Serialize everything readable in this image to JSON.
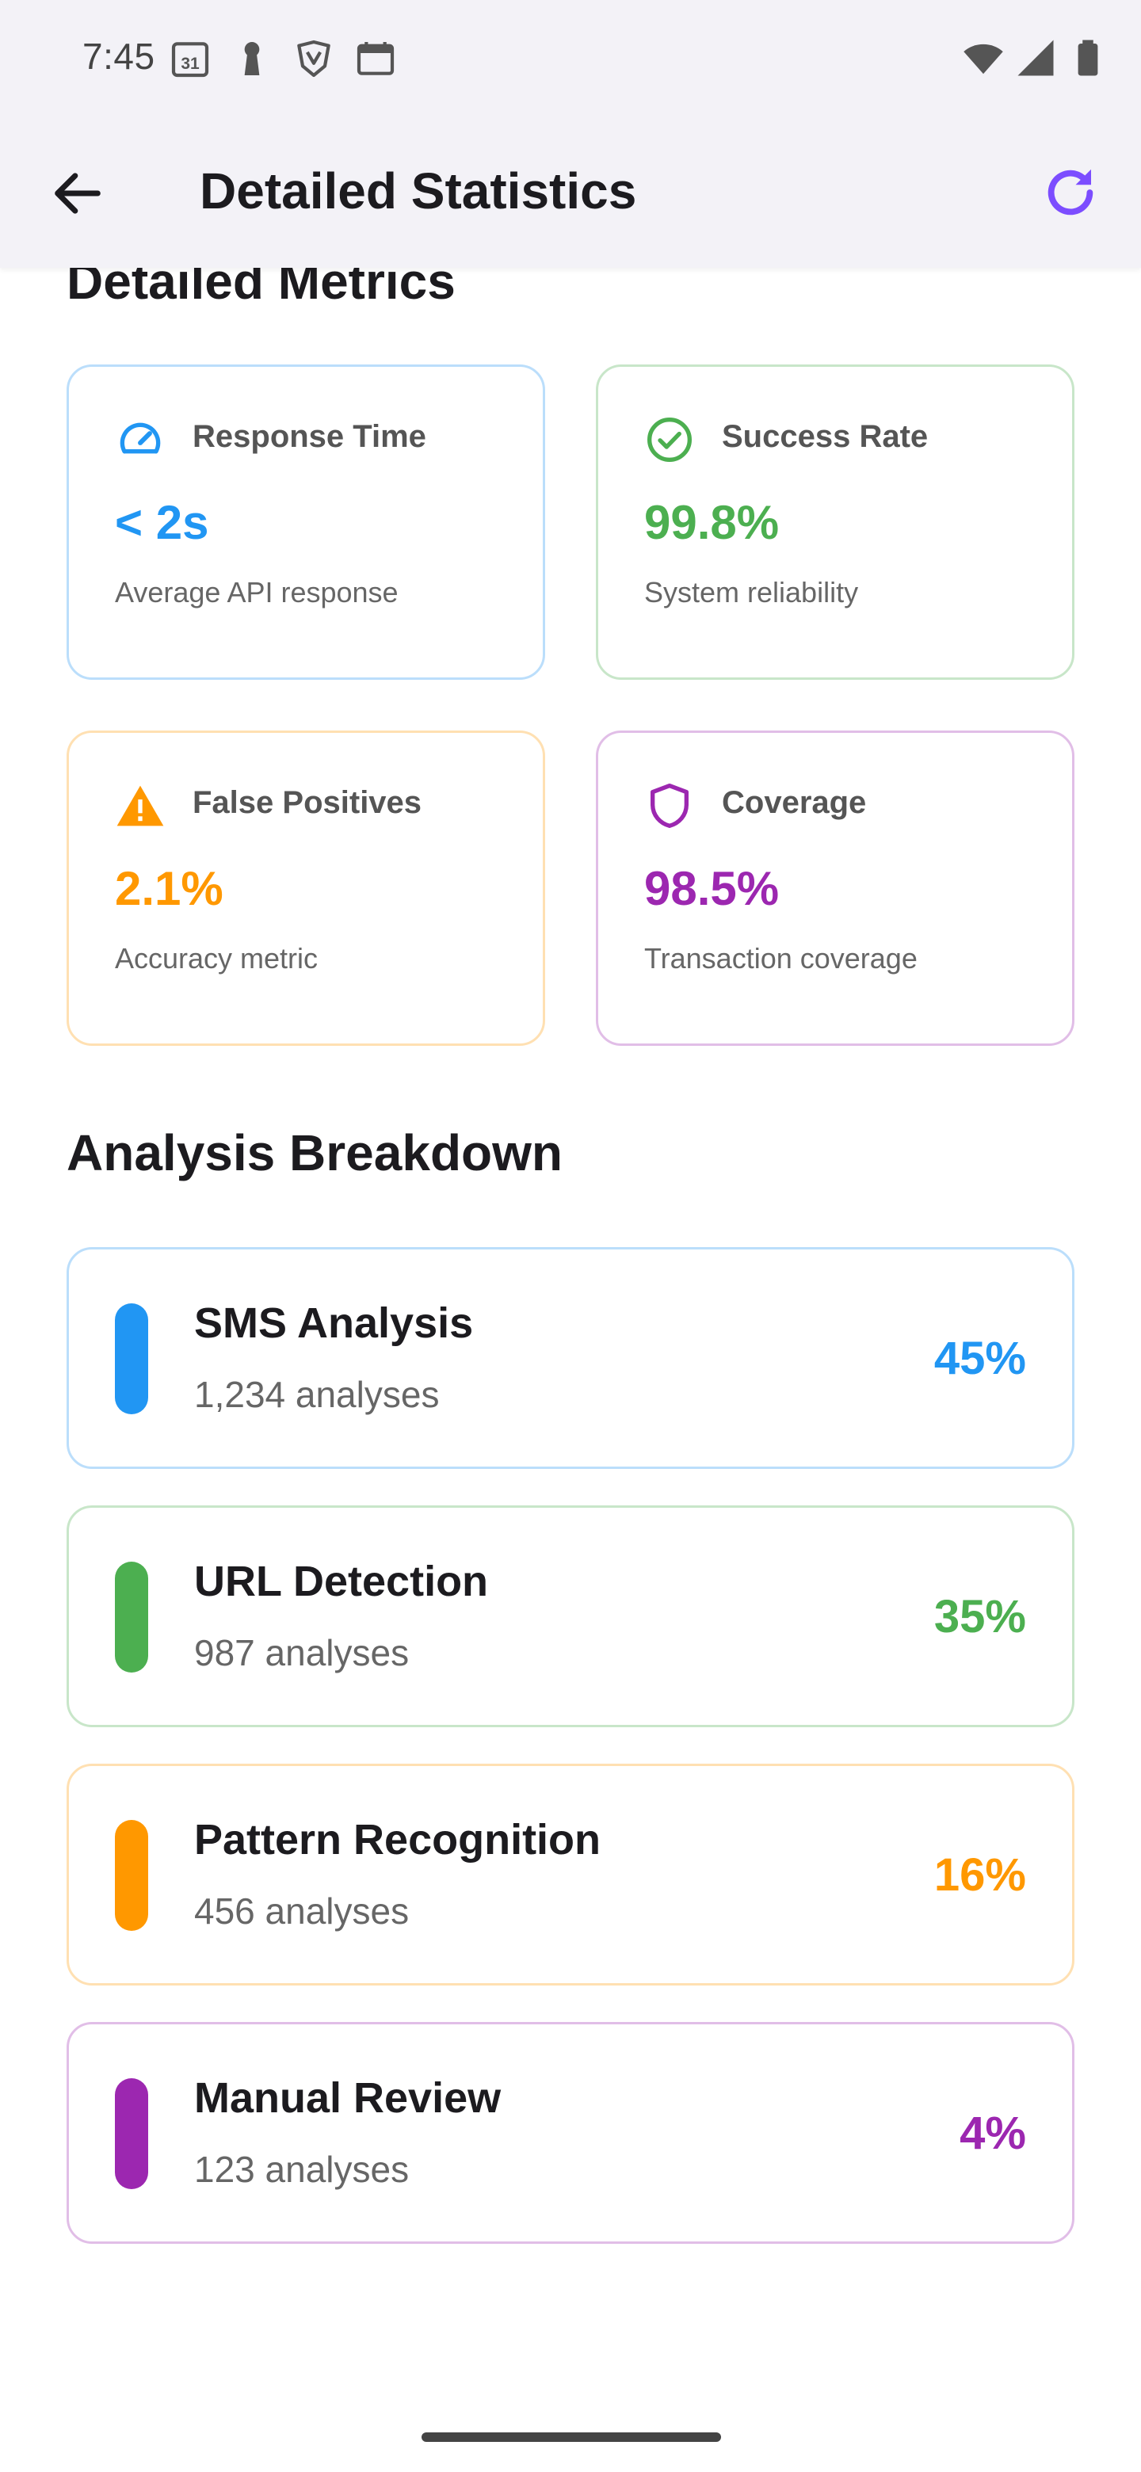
{
  "status_bar": {
    "time": "7:45",
    "left_icons": [
      "calendar-31-icon",
      "keyhole-icon",
      "brave-shield-icon",
      "calendar-grid-icon"
    ],
    "right_icons": [
      "wifi-icon",
      "cell-signal-icon",
      "battery-icon"
    ]
  },
  "app_bar": {
    "title": "Detailed Statistics",
    "back_icon": "arrow-back-icon",
    "refresh_icon": "refresh-icon",
    "accent": "#7c4dff"
  },
  "metrics": {
    "section_title": "Detailed Metrics",
    "cards": [
      {
        "icon": "speed-gauge-icon",
        "label": "Response Time",
        "value": "< 2s",
        "description": "Average API response",
        "color": "#2196f3",
        "border": "#bbdefb"
      },
      {
        "icon": "check-circle-icon",
        "label": "Success Rate",
        "value": "99.8%",
        "description": "System reliability",
        "color": "#4caf50",
        "border": "#c8e6c9"
      },
      {
        "icon": "warning-icon",
        "label": "False Positives",
        "value": "2.1%",
        "description": "Accuracy metric",
        "color": "#ff9800",
        "border": "#ffe0b2"
      },
      {
        "icon": "shield-icon",
        "label": "Coverage",
        "value": "98.5%",
        "description": "Transaction coverage",
        "color": "#9c27b0",
        "border": "#e1bee7"
      }
    ]
  },
  "breakdown": {
    "section_title": "Analysis Breakdown",
    "items": [
      {
        "title": "SMS Analysis",
        "count": "1,234 analyses",
        "percent": "45%",
        "color": "#2196f3",
        "border": "#bbdefb"
      },
      {
        "title": "URL Detection",
        "count": "987 analyses",
        "percent": "35%",
        "color": "#4caf50",
        "border": "#c8e6c9"
      },
      {
        "title": "Pattern Recognition",
        "count": "456 analyses",
        "percent": "16%",
        "color": "#ff9800",
        "border": "#ffe0b2"
      },
      {
        "title": "Manual Review",
        "count": "123 analyses",
        "percent": "4%",
        "color": "#9c27b0",
        "border": "#e1bee7"
      }
    ]
  }
}
